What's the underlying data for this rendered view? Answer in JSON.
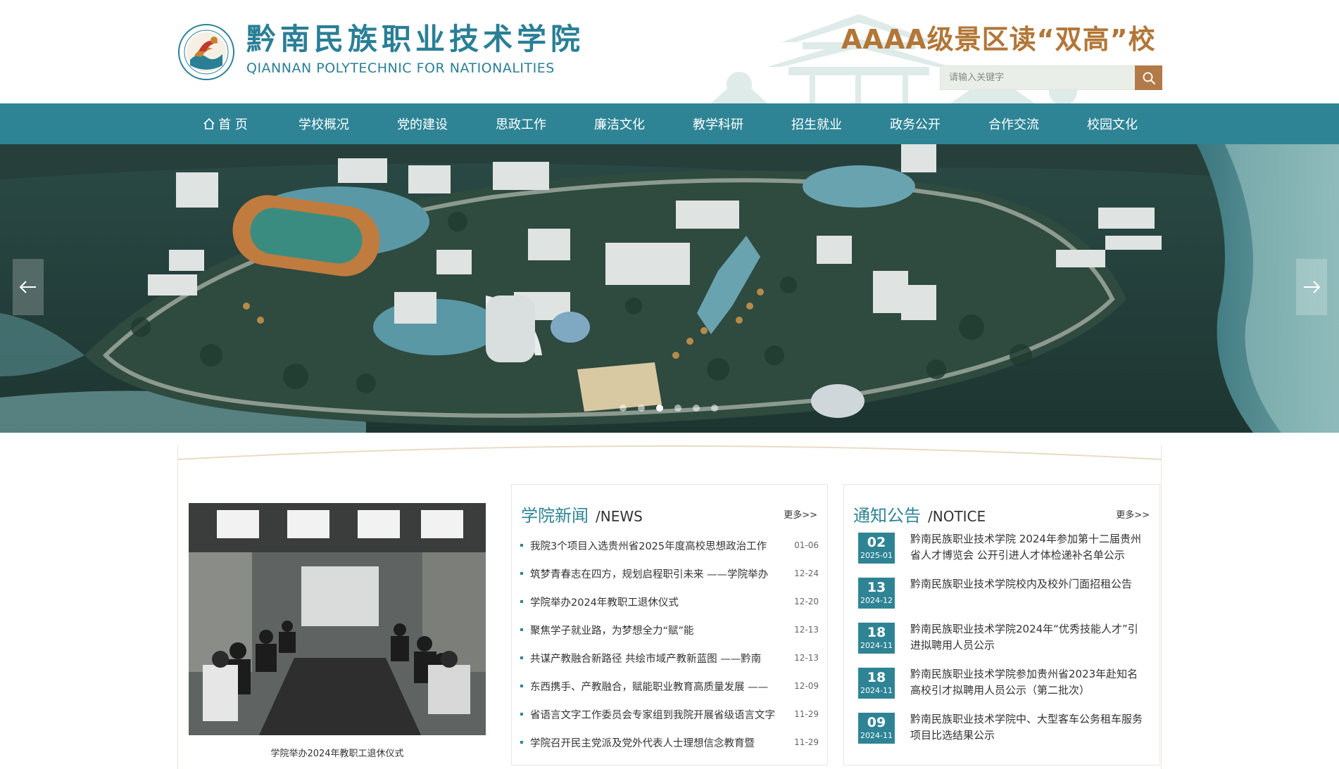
{
  "header": {
    "logo_cn": "黔南民族职业技术学院",
    "logo_en": "QIANNAN POLYTECHNIC FOR NATIONALITIES",
    "slogan": "AAAA级景区读“双高”校",
    "search": {
      "placeholder": "请输入关键字"
    }
  },
  "nav": {
    "items": [
      {
        "label": "首 页"
      },
      {
        "label": "学校概况"
      },
      {
        "label": "党的建设"
      },
      {
        "label": "思政工作"
      },
      {
        "label": "廉洁文化"
      },
      {
        "label": "教学科研"
      },
      {
        "label": "招生就业"
      },
      {
        "label": "政务公开"
      },
      {
        "label": "合作交流"
      },
      {
        "label": "校园文化"
      }
    ]
  },
  "banner": {
    "slide_count": 6,
    "active_index": 2
  },
  "photo": {
    "caption": "学院举办2024年教职工退休仪式"
  },
  "news": {
    "title_cn": "学院新闻",
    "title_en": "/NEWS",
    "more": "更多>>",
    "items": [
      {
        "title": "我院3个项目入选贵州省2025年度高校思想政治工作",
        "date": "01-06"
      },
      {
        "title": "筑梦青春志在四方，规划启程职引未来 ——学院举办",
        "date": "12-24"
      },
      {
        "title": "学院举办2024年教职工退休仪式",
        "date": "12-20"
      },
      {
        "title": "聚焦学子就业路，为梦想全力“赋”能",
        "date": "12-13"
      },
      {
        "title": "共谋产教融合新路径 共绘市域产教新蓝图 ——黔南",
        "date": "12-13"
      },
      {
        "title": "东西携手、产教融合，赋能职业教育高质量发展 ——",
        "date": "12-09"
      },
      {
        "title": "省语言文字工作委员会专家组到我院开展省级语言文字",
        "date": "11-29"
      },
      {
        "title": "学院召开民主党派及党外代表人士理想信念教育暨",
        "date": "11-29"
      }
    ]
  },
  "notice": {
    "title_cn": "通知公告",
    "title_en": "/NOTICE",
    "more": "更多>>",
    "items": [
      {
        "day": "02",
        "ym": "2025-01",
        "title": "黔南民族职业技术学院 2024年参加第十二届贵州省人才博览会 公开引进人才体检递补名单公示"
      },
      {
        "day": "13",
        "ym": "2024-12",
        "title": "黔南民族职业技术学院校内及校外门面招租公告"
      },
      {
        "day": "18",
        "ym": "2024-11",
        "title": "黔南民族职业技术学院2024年“优秀技能人才”引进拟聘用人员公示"
      },
      {
        "day": "18",
        "ym": "2024-11",
        "title": "黔南民族职业技术学院参加贵州省2023年赴知名高校引才拟聘用人员公示（第二批次）"
      },
      {
        "day": "09",
        "ym": "2024-11",
        "title": "黔南民族职业技术学院中、大型客车公务租车服务项目比选结果公示"
      }
    ]
  },
  "colors": {
    "brand_teal": "#2e8495",
    "slogan_gold": "#b27637",
    "search_button": "#b27a48"
  }
}
